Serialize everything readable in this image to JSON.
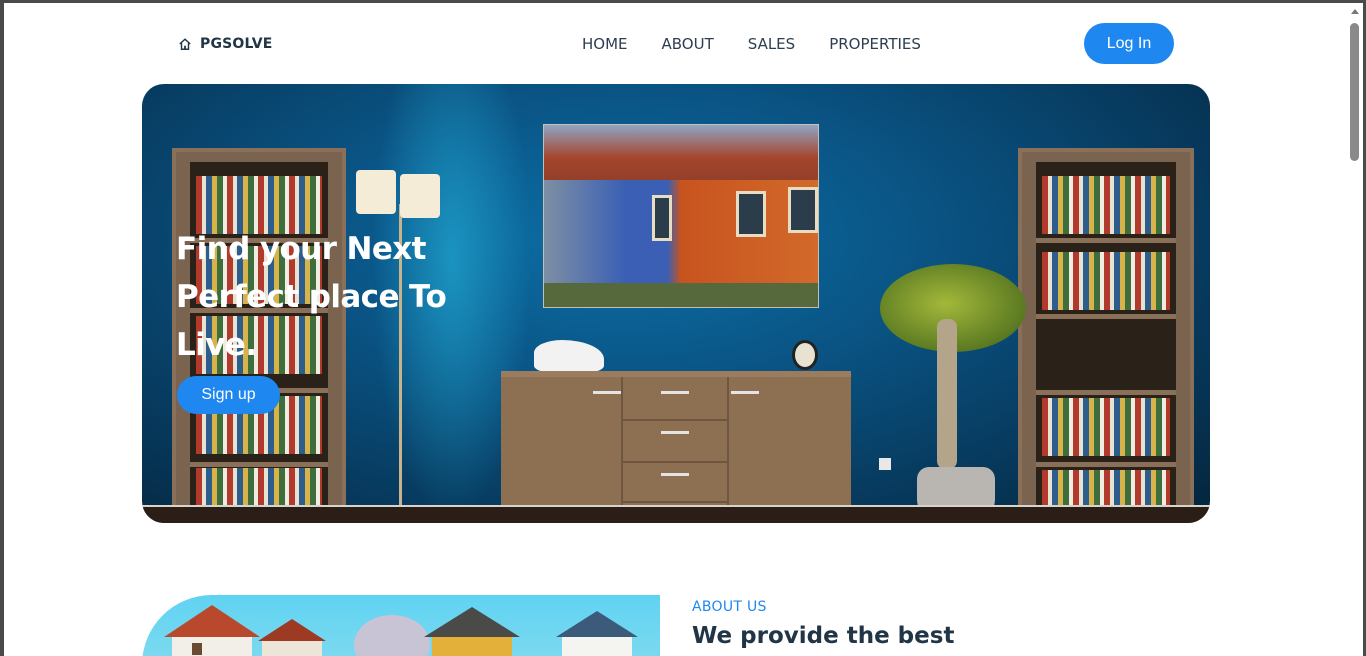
{
  "brand": {
    "name": "PGSOLVE",
    "icon": "home-icon"
  },
  "nav": {
    "items": [
      {
        "label": "HOME"
      },
      {
        "label": "ABOUT"
      },
      {
        "label": "SALES"
      },
      {
        "label": "PROPERTIES"
      }
    ],
    "login_label": "Log In"
  },
  "hero": {
    "title": "Find your Next Perfect place To Live.",
    "cta_label": "Sign up"
  },
  "about": {
    "label": "ABOUT US",
    "title": "We provide the best"
  },
  "colors": {
    "accent": "#1e88f0",
    "heading": "#213547",
    "hero_background": "#0a5586"
  }
}
